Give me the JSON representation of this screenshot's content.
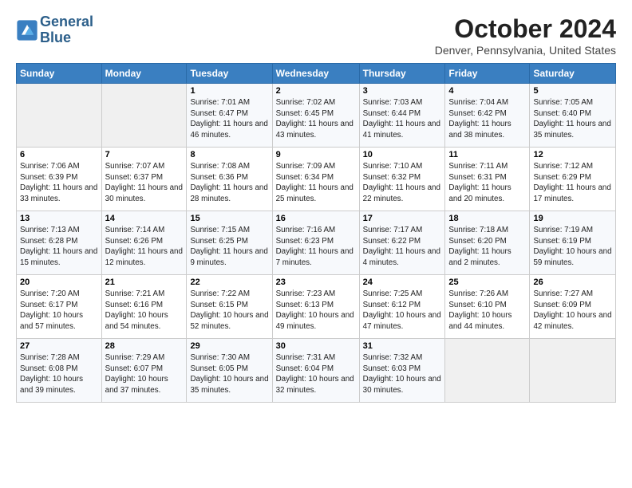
{
  "header": {
    "logo_line1": "General",
    "logo_line2": "Blue",
    "month": "October 2024",
    "location": "Denver, Pennsylvania, United States"
  },
  "weekdays": [
    "Sunday",
    "Monday",
    "Tuesday",
    "Wednesday",
    "Thursday",
    "Friday",
    "Saturday"
  ],
  "weeks": [
    [
      {
        "day": "",
        "info": ""
      },
      {
        "day": "",
        "info": ""
      },
      {
        "day": "1",
        "info": "Sunrise: 7:01 AM\nSunset: 6:47 PM\nDaylight: 11 hours and 46 minutes."
      },
      {
        "day": "2",
        "info": "Sunrise: 7:02 AM\nSunset: 6:45 PM\nDaylight: 11 hours and 43 minutes."
      },
      {
        "day": "3",
        "info": "Sunrise: 7:03 AM\nSunset: 6:44 PM\nDaylight: 11 hours and 41 minutes."
      },
      {
        "day": "4",
        "info": "Sunrise: 7:04 AM\nSunset: 6:42 PM\nDaylight: 11 hours and 38 minutes."
      },
      {
        "day": "5",
        "info": "Sunrise: 7:05 AM\nSunset: 6:40 PM\nDaylight: 11 hours and 35 minutes."
      }
    ],
    [
      {
        "day": "6",
        "info": "Sunrise: 7:06 AM\nSunset: 6:39 PM\nDaylight: 11 hours and 33 minutes."
      },
      {
        "day": "7",
        "info": "Sunrise: 7:07 AM\nSunset: 6:37 PM\nDaylight: 11 hours and 30 minutes."
      },
      {
        "day": "8",
        "info": "Sunrise: 7:08 AM\nSunset: 6:36 PM\nDaylight: 11 hours and 28 minutes."
      },
      {
        "day": "9",
        "info": "Sunrise: 7:09 AM\nSunset: 6:34 PM\nDaylight: 11 hours and 25 minutes."
      },
      {
        "day": "10",
        "info": "Sunrise: 7:10 AM\nSunset: 6:32 PM\nDaylight: 11 hours and 22 minutes."
      },
      {
        "day": "11",
        "info": "Sunrise: 7:11 AM\nSunset: 6:31 PM\nDaylight: 11 hours and 20 minutes."
      },
      {
        "day": "12",
        "info": "Sunrise: 7:12 AM\nSunset: 6:29 PM\nDaylight: 11 hours and 17 minutes."
      }
    ],
    [
      {
        "day": "13",
        "info": "Sunrise: 7:13 AM\nSunset: 6:28 PM\nDaylight: 11 hours and 15 minutes."
      },
      {
        "day": "14",
        "info": "Sunrise: 7:14 AM\nSunset: 6:26 PM\nDaylight: 11 hours and 12 minutes."
      },
      {
        "day": "15",
        "info": "Sunrise: 7:15 AM\nSunset: 6:25 PM\nDaylight: 11 hours and 9 minutes."
      },
      {
        "day": "16",
        "info": "Sunrise: 7:16 AM\nSunset: 6:23 PM\nDaylight: 11 hours and 7 minutes."
      },
      {
        "day": "17",
        "info": "Sunrise: 7:17 AM\nSunset: 6:22 PM\nDaylight: 11 hours and 4 minutes."
      },
      {
        "day": "18",
        "info": "Sunrise: 7:18 AM\nSunset: 6:20 PM\nDaylight: 11 hours and 2 minutes."
      },
      {
        "day": "19",
        "info": "Sunrise: 7:19 AM\nSunset: 6:19 PM\nDaylight: 10 hours and 59 minutes."
      }
    ],
    [
      {
        "day": "20",
        "info": "Sunrise: 7:20 AM\nSunset: 6:17 PM\nDaylight: 10 hours and 57 minutes."
      },
      {
        "day": "21",
        "info": "Sunrise: 7:21 AM\nSunset: 6:16 PM\nDaylight: 10 hours and 54 minutes."
      },
      {
        "day": "22",
        "info": "Sunrise: 7:22 AM\nSunset: 6:15 PM\nDaylight: 10 hours and 52 minutes."
      },
      {
        "day": "23",
        "info": "Sunrise: 7:23 AM\nSunset: 6:13 PM\nDaylight: 10 hours and 49 minutes."
      },
      {
        "day": "24",
        "info": "Sunrise: 7:25 AM\nSunset: 6:12 PM\nDaylight: 10 hours and 47 minutes."
      },
      {
        "day": "25",
        "info": "Sunrise: 7:26 AM\nSunset: 6:10 PM\nDaylight: 10 hours and 44 minutes."
      },
      {
        "day": "26",
        "info": "Sunrise: 7:27 AM\nSunset: 6:09 PM\nDaylight: 10 hours and 42 minutes."
      }
    ],
    [
      {
        "day": "27",
        "info": "Sunrise: 7:28 AM\nSunset: 6:08 PM\nDaylight: 10 hours and 39 minutes."
      },
      {
        "day": "28",
        "info": "Sunrise: 7:29 AM\nSunset: 6:07 PM\nDaylight: 10 hours and 37 minutes."
      },
      {
        "day": "29",
        "info": "Sunrise: 7:30 AM\nSunset: 6:05 PM\nDaylight: 10 hours and 35 minutes."
      },
      {
        "day": "30",
        "info": "Sunrise: 7:31 AM\nSunset: 6:04 PM\nDaylight: 10 hours and 32 minutes."
      },
      {
        "day": "31",
        "info": "Sunrise: 7:32 AM\nSunset: 6:03 PM\nDaylight: 10 hours and 30 minutes."
      },
      {
        "day": "",
        "info": ""
      },
      {
        "day": "",
        "info": ""
      }
    ]
  ]
}
